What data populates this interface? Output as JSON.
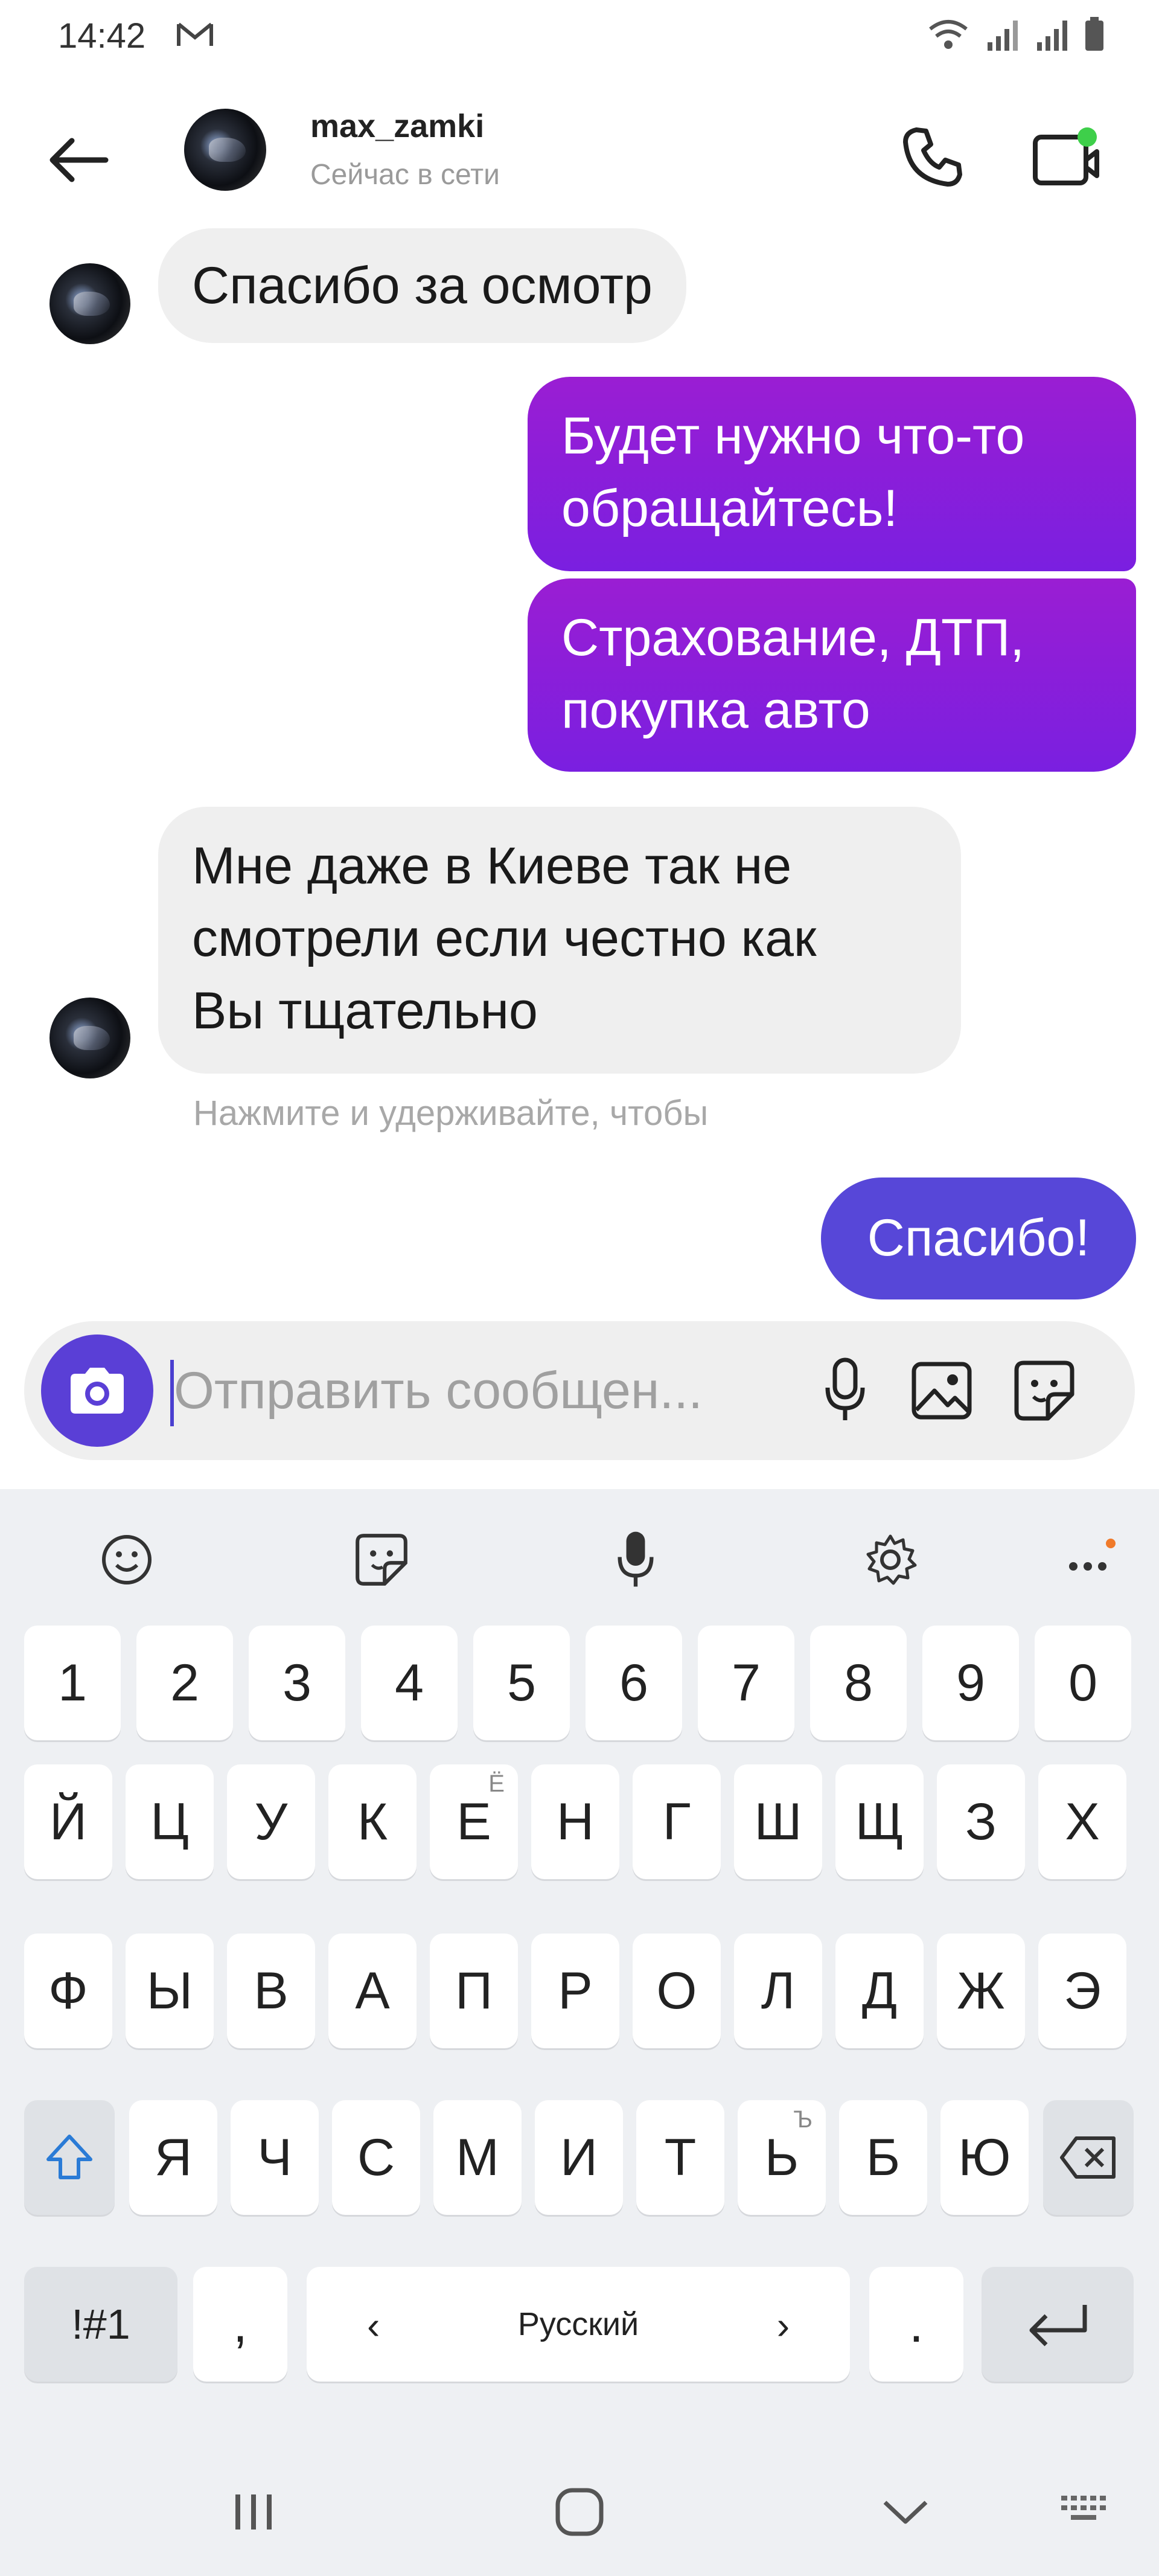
{
  "status_bar": {
    "time": "14:42",
    "icons": [
      "gmail-icon",
      "wifi-icon",
      "signal-icon",
      "signal-icon",
      "battery-icon"
    ]
  },
  "header": {
    "username": "max_zamki",
    "status": "Сейчас в сети",
    "online_dot_color": "#3ecf4a"
  },
  "messages": [
    {
      "direction": "in",
      "lines": [
        "Спасибо за осмотр"
      ]
    },
    {
      "direction": "out",
      "lines": [
        "Будет нужно что-то",
        "обращайтесь!"
      ]
    },
    {
      "direction": "out",
      "lines": [
        "Страхование,  ДТП,",
        "покупка авто"
      ]
    },
    {
      "direction": "in",
      "lines": [
        "Мне даже в Киеве так не",
        "смотрели если честно как",
        "Вы тщательно"
      ]
    },
    {
      "direction": "out",
      "lines": [
        "Спасибо!"
      ]
    }
  ],
  "hint": "Нажмите и удерживайте, чтобы",
  "composer": {
    "placeholder": "Отправить сообщен..."
  },
  "keyboard": {
    "number_row": [
      "1",
      "2",
      "3",
      "4",
      "5",
      "6",
      "7",
      "8",
      "9",
      "0"
    ],
    "row1": [
      "Й",
      "Ц",
      "У",
      "К",
      "Е",
      "Н",
      "Г",
      "Ш",
      "Щ",
      "З",
      "Х"
    ],
    "row1_sub": {
      "Е": "Ё"
    },
    "row2": [
      "Ф",
      "Ы",
      "В",
      "А",
      "П",
      "Р",
      "О",
      "Л",
      "Д",
      "Ж",
      "Э"
    ],
    "row3": [
      "Я",
      "Ч",
      "С",
      "М",
      "И",
      "Т",
      "Ь",
      "Б",
      "Ю"
    ],
    "row3_sub": {
      "Ь": "Ъ"
    },
    "symbols_key": "!#1",
    "comma_key": ",",
    "space_label": "Русский",
    "period_key": "."
  },
  "colors": {
    "accent": "#5a3fd6",
    "bubble_out_gradient": [
      "#9a1ed3",
      "#7a1fe0"
    ],
    "bubble_out_last": "#5747d8",
    "bubble_in": "#efefef"
  }
}
